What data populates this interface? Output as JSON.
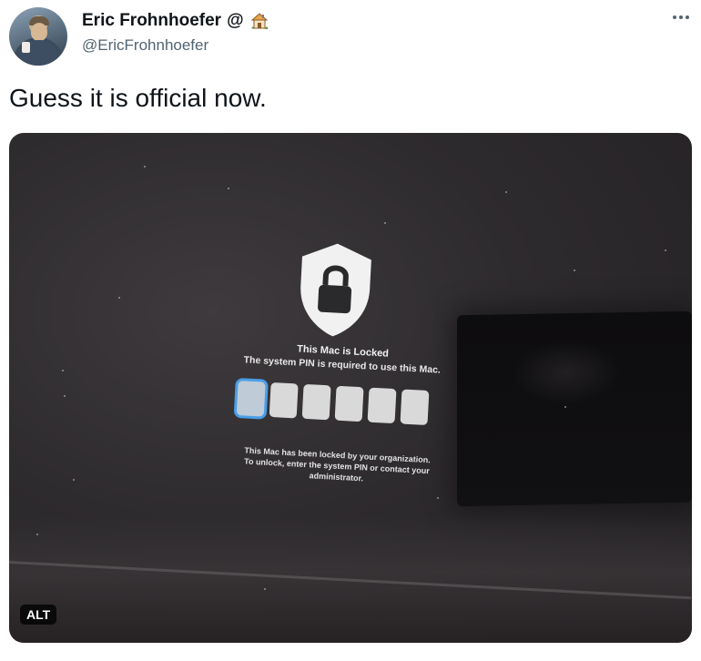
{
  "author": {
    "display_name": "Eric Frohnhoefer",
    "at_symbol": "@",
    "emoji_icon": "house-icon",
    "handle": "@EricFrohnhoefer"
  },
  "menu": {
    "icon": "more-icon"
  },
  "tweet": {
    "text": "Guess it is official now."
  },
  "media": {
    "lock_screen": {
      "icon": "shield-lock-icon",
      "title": "This Mac is Locked",
      "subtitle": "The system PIN is required to use this Mac.",
      "pin_length": 6,
      "footer_line1": "This Mac has been locked by your organization.",
      "footer_line2": "To unlock, enter the system PIN or contact your administrator."
    },
    "alt_label": "ALT"
  },
  "colors": {
    "text_primary": "#0f1419",
    "text_secondary": "#536471",
    "pin_focus": "#4a9ee6"
  }
}
